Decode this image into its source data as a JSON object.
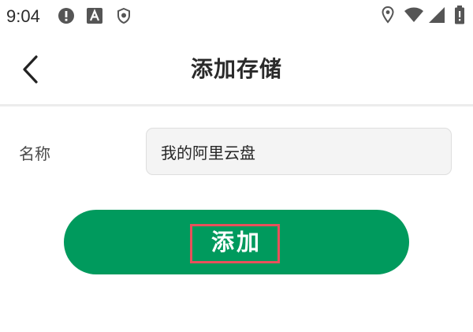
{
  "status_bar": {
    "time": "9:04",
    "icons": [
      "alert-icon",
      "app-a-icon",
      "shield-icon",
      "location-icon",
      "wifi-icon",
      "signal-icon",
      "battery-icon"
    ]
  },
  "header": {
    "title": "添加存储",
    "back_icon": "chevron-left-icon"
  },
  "form": {
    "name_label": "名称",
    "name_value": "我的阿里云盘"
  },
  "actions": {
    "add_label": "添加"
  },
  "colors": {
    "primary": "#009a5d",
    "highlight": "#e8505b",
    "field_bg": "#f4f4f4",
    "divider": "#ececec"
  }
}
